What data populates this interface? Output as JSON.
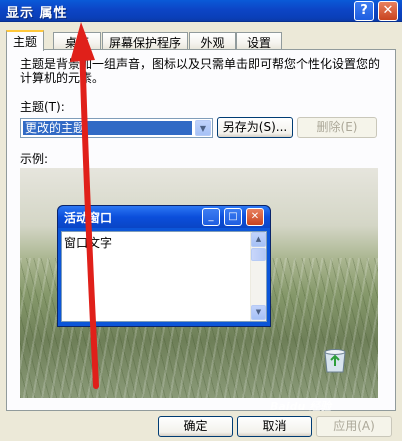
{
  "window": {
    "title": "显示 属性",
    "help_label": "?",
    "close_label": "✕"
  },
  "tabs": [
    {
      "label": "主题",
      "active": true
    },
    {
      "label": "桌面",
      "active": false
    },
    {
      "label": "屏幕保护程序",
      "active": false
    },
    {
      "label": "外观",
      "active": false
    },
    {
      "label": "设置",
      "active": false
    }
  ],
  "themes_page": {
    "description": "主题是背景加一组声音，图标以及只需单击即可帮您个性化设置您的计算机的元素。",
    "theme_label": "主题(T):",
    "theme_value": "更改的主题",
    "save_as_label": "另存为(S)...",
    "delete_label": "删除(E)",
    "sample_label": "示例:"
  },
  "preview_window": {
    "title": "活动窗口",
    "body_text": "窗口文字"
  },
  "footer": {
    "ok_label": "确定",
    "cancel_label": "取消",
    "apply_label": "应用(A)"
  },
  "watermark": "Baidu 经验",
  "colors": {
    "titlebar": "#0A4FD4",
    "selection": "#316AC5",
    "annotation_arrow": "#E0201A"
  }
}
